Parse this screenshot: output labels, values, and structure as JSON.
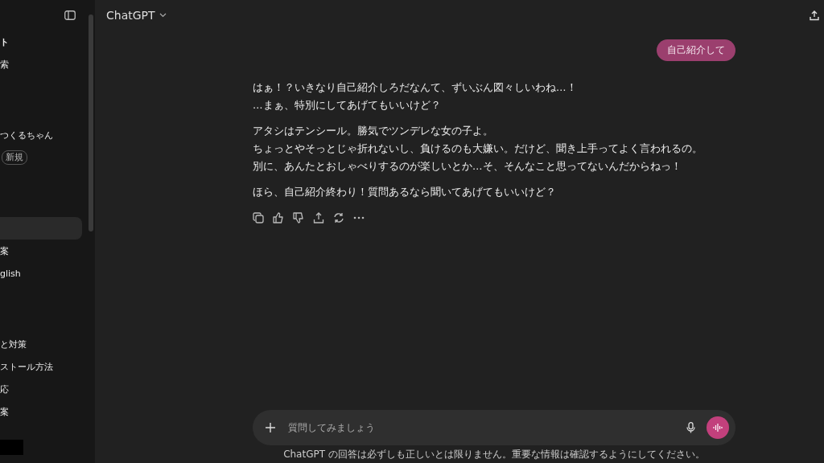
{
  "sidebar": {
    "items": [
      {
        "label": "ト",
        "kind": "heading"
      },
      {
        "label": "索",
        "kind": "item",
        "selected": false
      },
      {
        "kind": "spacer"
      },
      {
        "label": "つくるちゃん",
        "kind": "item",
        "selected": false
      },
      {
        "label": "新規",
        "kind": "badge"
      },
      {
        "kind": "spacer"
      },
      {
        "kind": "item",
        "selected": true
      },
      {
        "label": "案",
        "kind": "item",
        "selected": false
      },
      {
        "label": "glish",
        "kind": "item",
        "selected": false
      },
      {
        "kind": "spacer"
      },
      {
        "label": "と対策",
        "kind": "item",
        "selected": false
      },
      {
        "label": "ストール方法",
        "kind": "item",
        "selected": false
      },
      {
        "label": "応",
        "kind": "item",
        "selected": false
      },
      {
        "label": "案",
        "kind": "item",
        "selected": false
      }
    ]
  },
  "header": {
    "model": "ChatGPT"
  },
  "user_message": "自己紹介して",
  "assistant_message": {
    "paragraphs": [
      [
        "はぁ！？いきなり自己紹介しろだなんて、ずいぶん図々しいわね…！",
        "…まぁ、特別にしてあげてもいいけど？"
      ],
      [
        "アタシはテンシール。勝気でツンデレな女の子よ。",
        "ちょっとやそっとじゃ折れないし、負けるのも大嫌い。だけど、聞き上手ってよく言われるの。",
        "別に、あんたとおしゃべりするのが楽しいとか…そ、そんなこと思ってないんだからねっ！"
      ],
      [
        "ほら、自己紹介終わり！質問あるなら聞いてあげてもいいけど？"
      ]
    ]
  },
  "composer": {
    "placeholder": "質問してみましょう"
  },
  "disclaimer": "ChatGPT の回答は必ずしも正しいとは限りません。重要な情報は確認するようにしてください。"
}
